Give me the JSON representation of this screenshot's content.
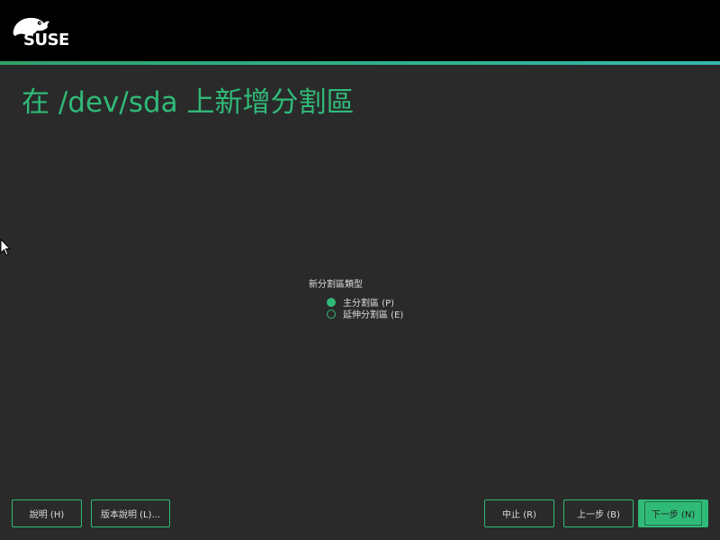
{
  "brand": {
    "logo_text": "SUSE",
    "accent_color": "#30ba78",
    "logo_icon": "chameleon-icon"
  },
  "page": {
    "title": "在 /dev/sda 上新增分割區"
  },
  "partition_type": {
    "label": "新分割區類型",
    "options": [
      {
        "label": "主分割區 (P)",
        "checked": true
      },
      {
        "label": "延伸分割區 (E)",
        "checked": false
      }
    ]
  },
  "footer": {
    "help_label": "說明 (H)",
    "release_notes_label": "版本說明 (L)...",
    "abort_label": "中止 (R)",
    "back_label": "上一步 (B)",
    "next_label": "下一步 (N)"
  }
}
